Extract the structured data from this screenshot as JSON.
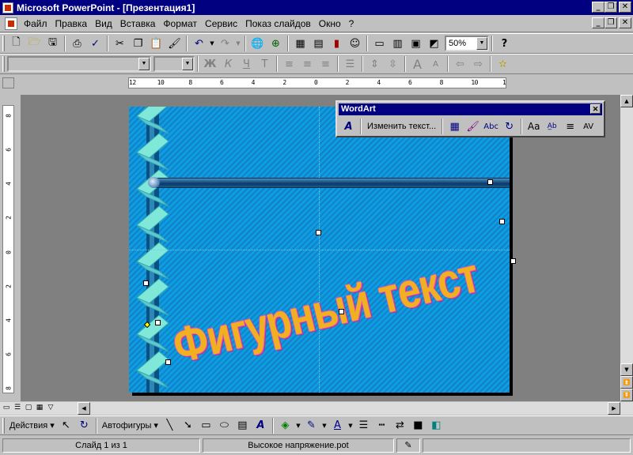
{
  "window": {
    "title": "Microsoft PowerPoint - [Презентация1]",
    "min": "_",
    "restore": "❐",
    "close": "✕"
  },
  "menu": {
    "items": [
      "Файл",
      "Правка",
      "Вид",
      "Вставка",
      "Формат",
      "Сервис",
      "Показ слайдов",
      "Окно",
      "?"
    ]
  },
  "standard_toolbar": {
    "zoom": "50%"
  },
  "formatting_toolbar": {
    "font": "",
    "size": ""
  },
  "ruler": {
    "h_ticks": [
      "12",
      "10",
      "8",
      "6",
      "4",
      "2",
      "0",
      "2",
      "4",
      "6",
      "8",
      "10",
      "12"
    ],
    "v_ticks": [
      "8",
      "6",
      "4",
      "2",
      "0",
      "2",
      "4",
      "6",
      "8"
    ]
  },
  "slide": {
    "wordart_text": "Фигурный текст"
  },
  "wordart_toolbar": {
    "title": "WordArt",
    "edit_text": "Изменить текст...",
    "close": "✕"
  },
  "drawing_toolbar": {
    "actions": "Действия",
    "autoshapes": "Автофигуры"
  },
  "status": {
    "slide": "Слайд 1 из 1",
    "design": "Высокое напряжение.pot"
  },
  "colors": {
    "title_bar": "#000080",
    "slide_background": "#0c9ee0",
    "wordart_fill": "#f0b020",
    "wordart_outline": "#e050c0"
  }
}
